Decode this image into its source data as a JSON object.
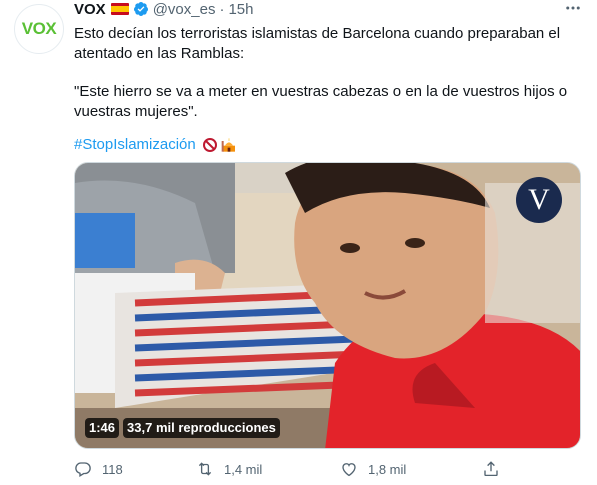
{
  "avatar": {
    "text": "VOX",
    "color": "#5ac035"
  },
  "author": {
    "name": "VOX",
    "handle": "@vox_es",
    "separator": "·",
    "time": "15h",
    "flag_icon": "spain-flag-icon",
    "verified_icon": "verified-badge-icon"
  },
  "tweet": {
    "line1": "Esto decían los terroristas islamistas de Barcelona cuando preparaban el atentado en las Ramblas:",
    "line2": "\"Este hierro se va a meter en vuestras cabezas o en la de vuestros hijos o vuestras mujeres\".",
    "hashtag": "#StopIslamización",
    "emojis": [
      "prohibited-icon",
      "mosque-icon"
    ]
  },
  "media": {
    "duration": "1:46",
    "views": "33,7 mil reproducciones",
    "watermark": "V"
  },
  "actions": {
    "reply_count": "118",
    "retweet_count": "1,4 mil",
    "like_count": "1,8 mil"
  },
  "colors": {
    "link": "#1d9bf0",
    "muted": "#536471",
    "text": "#0f1419"
  }
}
